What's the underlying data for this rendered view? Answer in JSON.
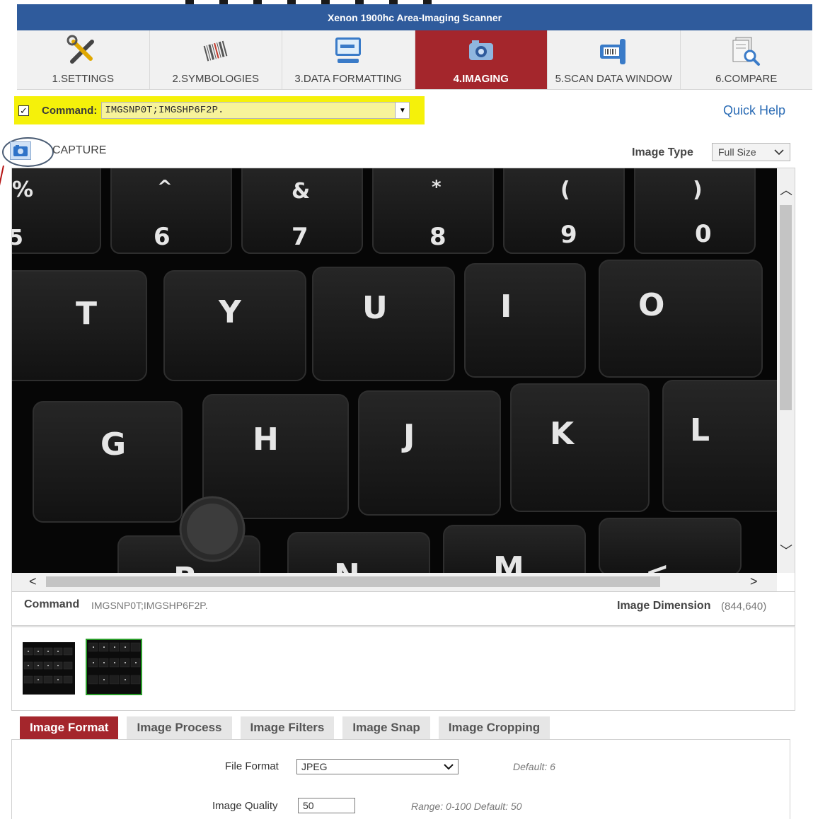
{
  "window": {
    "title": "Xenon 1900hc Area-Imaging Scanner"
  },
  "nav_tabs": [
    {
      "label": "1.SETTINGS",
      "icon": "tools-icon"
    },
    {
      "label": "2.SYMBOLOGIES",
      "icon": "barcode-icon"
    },
    {
      "label": "3.DATA FORMATTING",
      "icon": "monitor-icon"
    },
    {
      "label": "4.IMAGING",
      "icon": "camera-icon",
      "active": true
    },
    {
      "label": "5.SCAN DATA WINDOW",
      "icon": "scanner-icon"
    },
    {
      "label": "6.COMPARE",
      "icon": "document-search-icon"
    }
  ],
  "command": {
    "checked": true,
    "label": "Command:",
    "value": "IMGSNP0T;IMGSHP6F2P."
  },
  "quick_help": "Quick Help",
  "capture": {
    "label": "CAPTURE"
  },
  "image_type": {
    "label": "Image Type",
    "value": "Full Size"
  },
  "image": {
    "keys_row1": [
      "%",
      "^",
      "&",
      "*",
      "(",
      ")"
    ],
    "keys_row2": [
      "5",
      "6",
      "7",
      "8",
      "9",
      "0"
    ],
    "keys_row3": [
      "T",
      "Y",
      "U",
      "I",
      "O"
    ],
    "keys_row4": [
      "G",
      "H",
      "J",
      "K",
      "L"
    ],
    "keys_row5": [
      "B",
      "N",
      "M",
      "<"
    ]
  },
  "info": {
    "command_label": "Command",
    "command_value": "IMGSNP0T;IMGSHP6F2P.",
    "dimension_label": "Image Dimension",
    "dimension_value": "(844,640)"
  },
  "bottom_tabs": [
    {
      "label": "Image Format",
      "active": true
    },
    {
      "label": "Image Process"
    },
    {
      "label": "Image Filters"
    },
    {
      "label": "Image Snap"
    },
    {
      "label": "Image Cropping"
    }
  ],
  "format_panel": {
    "file_format_label": "File Format",
    "file_format_value": "JPEG",
    "file_format_hint": "Default: 6",
    "quality_label": "Image Quality",
    "quality_value": "50",
    "quality_hint": "Range: 0-100  Default: 50"
  },
  "colors": {
    "title_bar": "#2f5b9c",
    "active_tab": "#a4262c",
    "highlight": "#f5f10a",
    "link": "#2b6cb5"
  }
}
